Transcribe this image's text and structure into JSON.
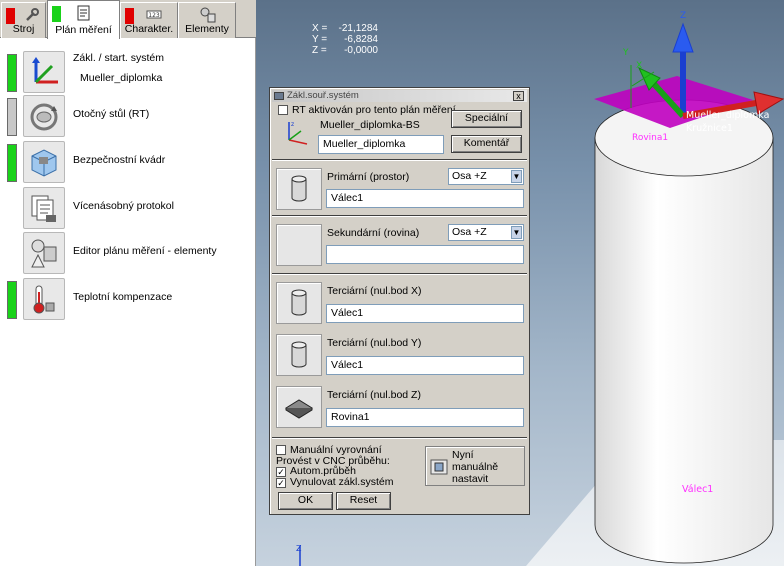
{
  "tabs": [
    {
      "label": "Stroj",
      "flag": "red",
      "icon": "wrench-icon"
    },
    {
      "label": "Plán měření",
      "flag": "green",
      "icon": "plan-icon"
    },
    {
      "label": "Charakter.",
      "flag": "red",
      "icon": "characteristics-icon"
    },
    {
      "label": "Elementy",
      "flag": "none",
      "icon": "elements-icon"
    }
  ],
  "panel": {
    "items": [
      {
        "label": "Zákl. / start. systém",
        "sub": "Mueller_diplomka",
        "indicator": "green",
        "icon": "coordinate-system-icon"
      },
      {
        "label": "Otočný stůl (RT)",
        "sub": "",
        "indicator": "gray",
        "icon": "rotary-table-icon"
      },
      {
        "label": "Bezpečnostní kvádr",
        "sub": "",
        "indicator": "green",
        "icon": "safety-box-icon"
      },
      {
        "label": "Vícenásobný protokol",
        "sub": "",
        "indicator": "none",
        "icon": "protocol-icon"
      },
      {
        "label": "Editor plánu měření - elementy",
        "sub": "",
        "indicator": "none",
        "icon": "elements-editor-icon"
      },
      {
        "label": "Teplotní kompenzace",
        "sub": "",
        "indicator": "green",
        "icon": "thermometer-icon"
      }
    ]
  },
  "viewport": {
    "coords": [
      {
        "axis": "X =",
        "value": "-21,1284"
      },
      {
        "axis": "Y =",
        "value": "-6,8284"
      },
      {
        "axis": "Z =",
        "value": "-0,0000"
      }
    ],
    "labels": {
      "mueller": "Mueller_diplomka",
      "kruznice": "Kružnice1",
      "rovina": "Rovina1",
      "valec": "Válec1",
      "axis_z": "Z",
      "axis_y": "Y",
      "axis_x": "X"
    }
  },
  "dialog": {
    "title": "Zákl.souř.systém",
    "close": "x",
    "rt_checkbox": "RT aktivován pro tento plán měření",
    "rt_checked": false,
    "base_name": "Mueller_diplomka-BS",
    "special_button": "Speciální",
    "name_field": "Mueller_diplomka",
    "comment_button": "Komentář",
    "primary": {
      "label": "Primární (prostor)",
      "axis": "Osa +Z",
      "element": "Válec1"
    },
    "secondary": {
      "label": "Sekundární (rovina)",
      "axis": "Osa +Z",
      "element": ""
    },
    "tertiary_x": {
      "label": "Terciární (nul.bod X)",
      "element": "Válec1"
    },
    "tertiary_y": {
      "label": "Terciární (nul.bod Y)",
      "element": "Válec1"
    },
    "tertiary_z": {
      "label": "Terciární (nul.bod Z)",
      "element": "Rovina1"
    },
    "manual_align": {
      "label": "Manuální vyrovnání",
      "checked": false
    },
    "cnc_label": "Provést v CNC průběhu:",
    "auto_run": {
      "label": "Autom.průběh",
      "checked": true
    },
    "reset_base": {
      "label": "Vynulovat zákl.systém",
      "checked": true
    },
    "now_manual_button": [
      "Nyní",
      "manuálně",
      "nastavit"
    ],
    "ok_button": "OK",
    "reset_button": "Reset"
  },
  "colors": {
    "indicator_green": "#19d219",
    "flag_red": "#e00000",
    "indicator_gray": "#c8c8c8",
    "plane_magenta": "#c000c0",
    "label_magenta": "#ff30ff"
  }
}
